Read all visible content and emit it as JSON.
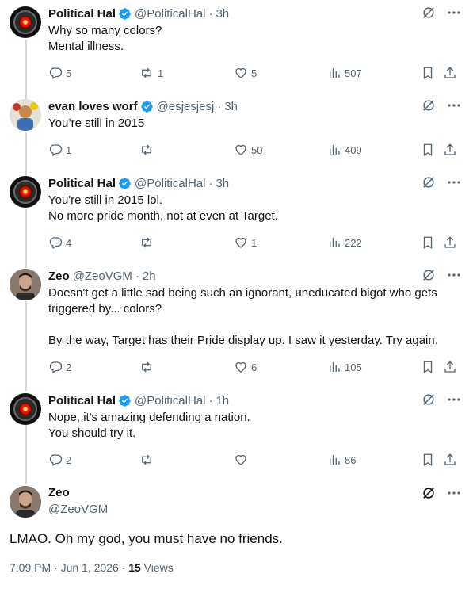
{
  "tweets": [
    {
      "name": "Political Hal",
      "handle": "@PoliticalHal",
      "time": "3h",
      "avatar": "hal-9000-red-eye",
      "lines": [
        "Why so many colors?",
        "Mental illness."
      ],
      "replies": "5",
      "reposts": "1",
      "likes": "5",
      "views": "507"
    },
    {
      "name": "evan loves worf",
      "handle": "@esjesjesj",
      "time": "3h",
      "avatar": "evan-photo",
      "lines": [
        "You’re still in 2015"
      ],
      "replies": "1",
      "reposts": "",
      "likes": "50",
      "views": "409"
    },
    {
      "name": "Political Hal",
      "handle": "@PoliticalHal",
      "time": "3h",
      "avatar": "hal-9000-red-eye",
      "lines": [
        "You're still in 2015 lol.",
        "No more pride month, not at even at Target."
      ],
      "replies": "4",
      "reposts": "",
      "likes": "1",
      "views": "222"
    },
    {
      "name": "Zeo",
      "handle": "@ZeoVGM",
      "time": "2h",
      "avatar": "zeo-photo",
      "lines": [
        "Doesn't get a little sad being such an ignorant, uneducated bigot who gets",
        "triggered by... colors?",
        "",
        "By the way, Target has their Pride display up. I saw it yesterday. Try again."
      ],
      "replies": "2",
      "reposts": "",
      "likes": "6",
      "views": "105"
    },
    {
      "name": "Political Hal",
      "handle": "@PoliticalHal",
      "time": "1h",
      "avatar": "hal-9000-red-eye",
      "lines": [
        "Nope, it's amazing defending a nation.",
        "You should try it."
      ],
      "replies": "2",
      "reposts": "",
      "likes": "",
      "views": "86"
    }
  ],
  "main_tweet": {
    "name": "Zeo",
    "handle": "@ZeoVGM",
    "text": "LMAO. Oh my god, you must have no friends.",
    "timestamp": "7:09 PM · Jun 1, 2026 · ",
    "views_count": "15",
    "views_label": " Views"
  },
  "colors": {
    "text": "#0f1419",
    "secondary": "#536471",
    "verified": "#1d9bf0",
    "thread_line": "#cfd9de"
  }
}
